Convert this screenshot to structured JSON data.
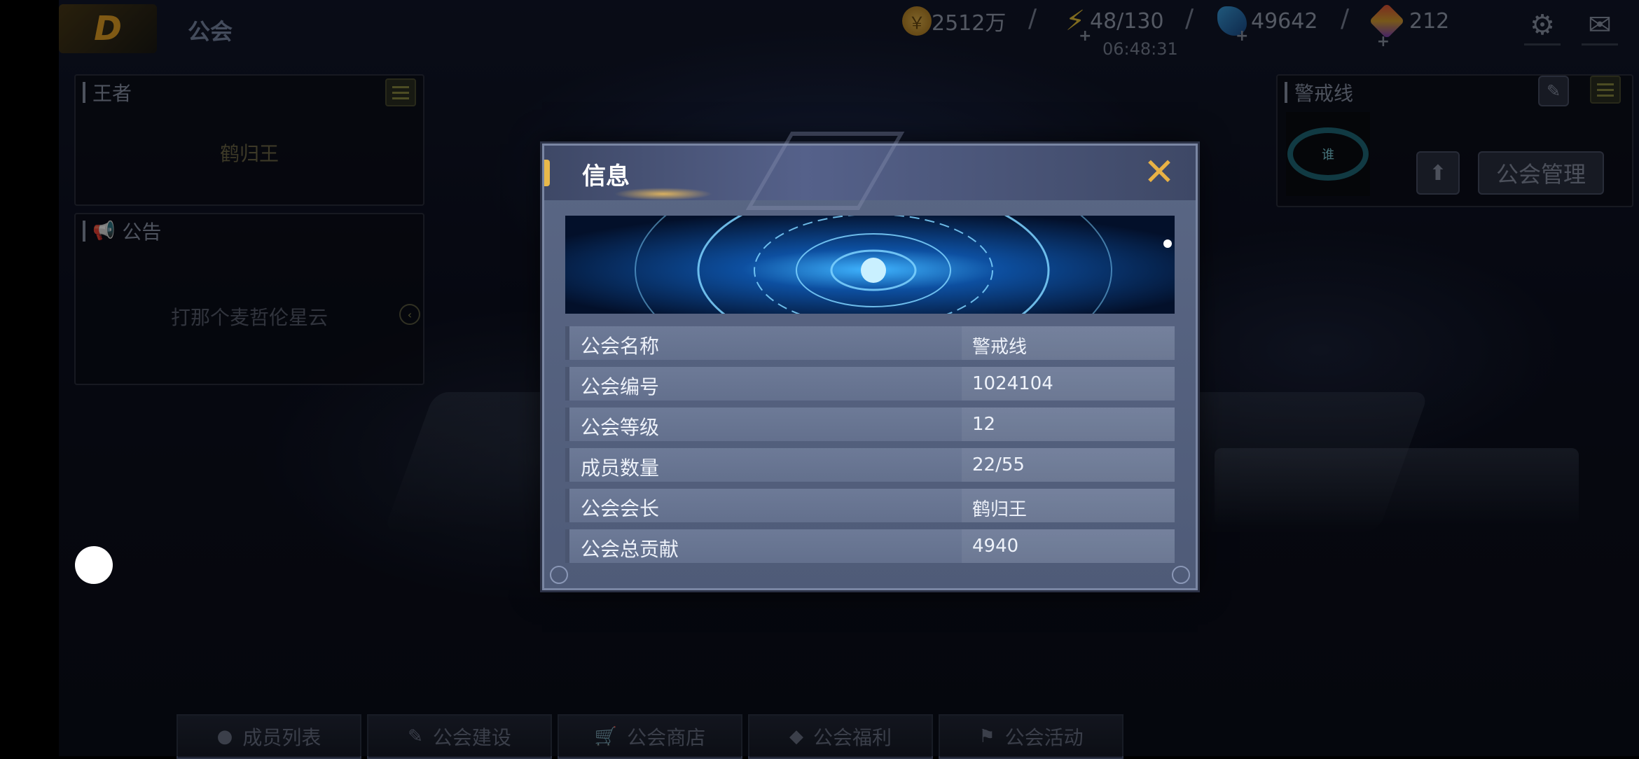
{
  "top_bar": {
    "logo": "D",
    "page_title": "公会",
    "gold": {
      "value": "2512万",
      "icon": "gold-coin-icon"
    },
    "energy": {
      "value": "48/130",
      "icon": "lightning-icon"
    },
    "crystal": {
      "value": "49642",
      "icon": "crystal-icon"
    },
    "gem": {
      "value": "212",
      "icon": "gem-icon"
    },
    "separator": "/",
    "plus": "+",
    "timer": "06:48:31",
    "settings_icon": "⚙",
    "mail_icon": "✉"
  },
  "left_panels": {
    "king": {
      "title": "王者",
      "name": "鹤归王"
    },
    "announcement": {
      "title": "公告",
      "text": "打那个麦哲伦星云"
    }
  },
  "right_panel": {
    "guild_name": "警戒线",
    "emblem_text": "谁",
    "upgrade_icon": "⬆",
    "manage_button": "公会管理"
  },
  "bottom_tabs": [
    {
      "label": "成员列表",
      "icon": "●"
    },
    {
      "label": "公会建设",
      "icon": "✎"
    },
    {
      "label": "公会商店",
      "icon": "🛒"
    },
    {
      "label": "公会福利",
      "icon": "◆"
    },
    {
      "label": "公会活动",
      "icon": "⚑"
    }
  ],
  "modal": {
    "title": "信息",
    "close": "✕",
    "rows": [
      {
        "label": "公会名称",
        "value": "警戒线"
      },
      {
        "label": "公会编号",
        "value": "1024104"
      },
      {
        "label": "公会等级",
        "value": "12"
      },
      {
        "label": "成员数量",
        "value": "22/55"
      },
      {
        "label": "公会会长",
        "value": "鹤归王"
      },
      {
        "label": "公会总贡献",
        "value": "4940"
      }
    ]
  },
  "colors": {
    "accent_gold": "#e9b245",
    "modal_bg": "#55618a",
    "row_bg": "#6d7a97"
  }
}
